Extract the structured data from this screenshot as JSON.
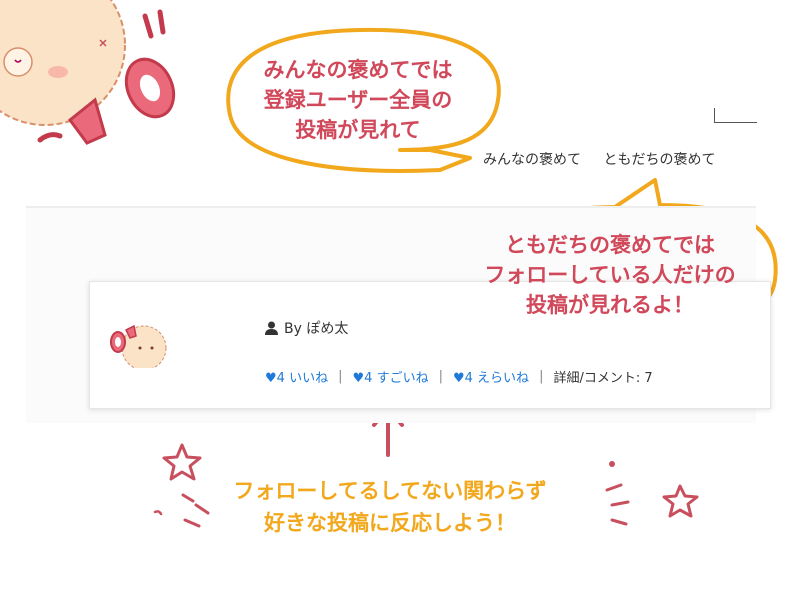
{
  "nav": {
    "items": [
      "みんなの褒めて",
      "ともだちの褒めて"
    ]
  },
  "bubbles": {
    "top_lines": [
      "みんなの褒めてでは",
      "登録ユーザー全員の",
      "投稿が見れて"
    ],
    "right_lines": [
      "ともだちの褒めてでは",
      "フォローしている人だけの",
      "投稿が見れるよ！"
    ]
  },
  "card": {
    "author": "By ぽめ太",
    "reactions": [
      {
        "count": "♥4",
        "label": "いいね"
      },
      {
        "count": "♥4",
        "label": "すごいね"
      },
      {
        "count": "♥4",
        "label": "えらいね"
      }
    ],
    "detail": "詳細/コメント: 7"
  },
  "message": {
    "lines": [
      "フォローしてるしてない関わらず",
      "好きな投稿に反応しよう！"
    ]
  },
  "colors": {
    "accent_red": "#d0485a",
    "accent_yellow": "#f2a81d",
    "link_blue": "#1e7ad6"
  }
}
